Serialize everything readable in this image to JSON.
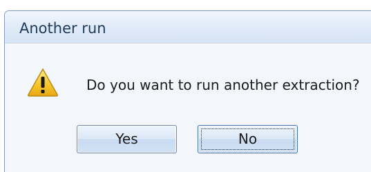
{
  "dialog": {
    "title": "Another run",
    "icon": "warning-icon",
    "message": "Do you want to run another extraction?",
    "buttons": {
      "yes_label": "Yes",
      "no_label": "No",
      "focused": "No"
    }
  },
  "colors": {
    "title_text": "#1e3959",
    "titlebar": "#dfe9f7",
    "body_bg": "#f3f6fb",
    "button_face": "#d6e4f5",
    "warning_fill": "#f7c52a"
  }
}
